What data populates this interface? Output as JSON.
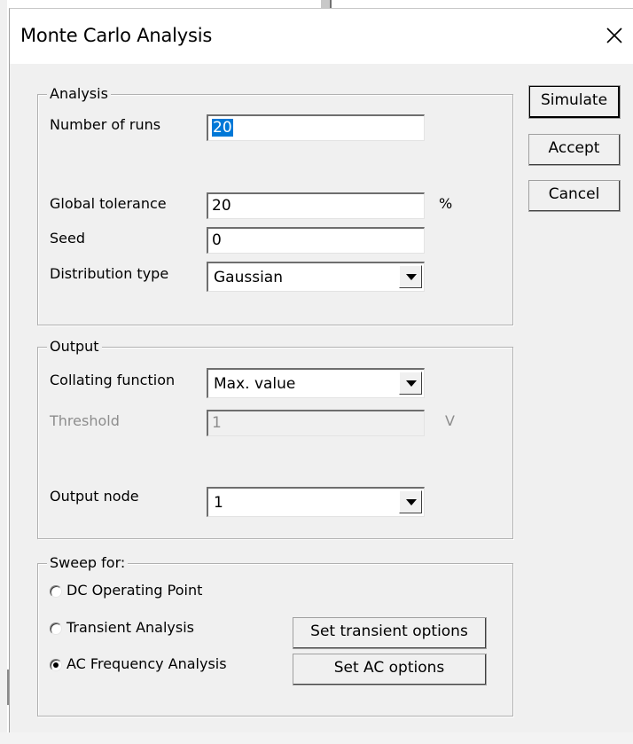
{
  "dialog": {
    "title": "Monte Carlo Analysis"
  },
  "buttons": {
    "simulate": "Simulate",
    "accept": "Accept",
    "cancel": "Cancel"
  },
  "analysis": {
    "legend": "Analysis",
    "number_of_runs_label": "Number of runs",
    "number_of_runs_value": "20",
    "global_tolerance_label": "Global tolerance",
    "global_tolerance_value": "20",
    "global_tolerance_unit": "%",
    "seed_label": "Seed",
    "seed_value": "0",
    "distribution_type_label": "Distribution type",
    "distribution_type_value": "Gaussian"
  },
  "output": {
    "legend": "Output",
    "collating_function_label": "Collating function",
    "collating_function_value": "Max. value",
    "threshold_label": "Threshold",
    "threshold_value": "1",
    "threshold_unit": "V",
    "output_node_label": "Output node",
    "output_node_value": "1"
  },
  "sweep": {
    "legend": "Sweep for:",
    "options": [
      {
        "label": "DC Operating Point",
        "checked": false
      },
      {
        "label": "Transient Analysis",
        "checked": false
      },
      {
        "label": "AC Frequency Analysis",
        "checked": true
      }
    ],
    "set_transient_options": "Set transient options",
    "set_ac_options": "Set AC options"
  },
  "icons": {
    "close": "close-icon",
    "dropdown": "chevron-down-icon"
  },
  "colors": {
    "dialog_bg": "#f0f0f0",
    "selection": "#0078d7",
    "disabled_text": "#8d8d8d"
  }
}
